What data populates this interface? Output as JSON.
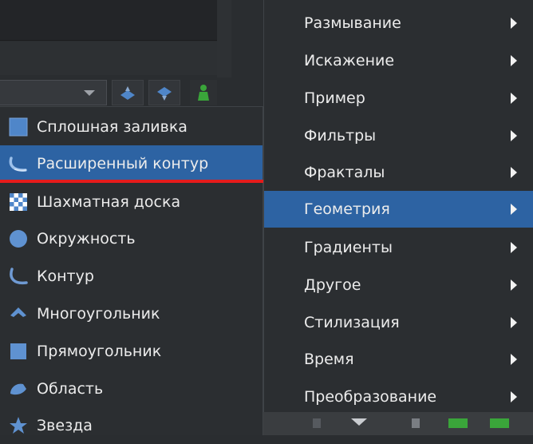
{
  "left_menu": {
    "items": [
      {
        "label": "Сплошная заливка",
        "icon": "solid-fill-icon"
      },
      {
        "label": "Расширенный контур",
        "icon": "advanced-outline-icon",
        "highlighted": true
      },
      {
        "label": "Шахматная доска",
        "icon": "checkerboard-icon"
      },
      {
        "label": "Окружность",
        "icon": "circle-icon"
      },
      {
        "label": "Контур",
        "icon": "outline-icon"
      },
      {
        "label": "Многоугольник",
        "icon": "polygon-icon"
      },
      {
        "label": "Прямоугольник",
        "icon": "rectangle-icon"
      },
      {
        "label": "Область",
        "icon": "region-icon"
      },
      {
        "label": "Звезда",
        "icon": "star-icon"
      }
    ]
  },
  "right_menu": {
    "items": [
      {
        "label": "Размывание"
      },
      {
        "label": "Искажение"
      },
      {
        "label": "Пример"
      },
      {
        "label": "Фильтры"
      },
      {
        "label": "Фракталы"
      },
      {
        "label": "Геометрия",
        "highlighted": true
      },
      {
        "label": "Градиенты"
      },
      {
        "label": "Другое"
      },
      {
        "label": "Стилизация"
      },
      {
        "label": "Время"
      },
      {
        "label": "Преобразование"
      }
    ]
  },
  "colors": {
    "highlight": "#2d63a3",
    "menu_bg": "#2b2e31",
    "annotation_underline": "#e51b1b",
    "icon_blue": "#4f86c9"
  }
}
